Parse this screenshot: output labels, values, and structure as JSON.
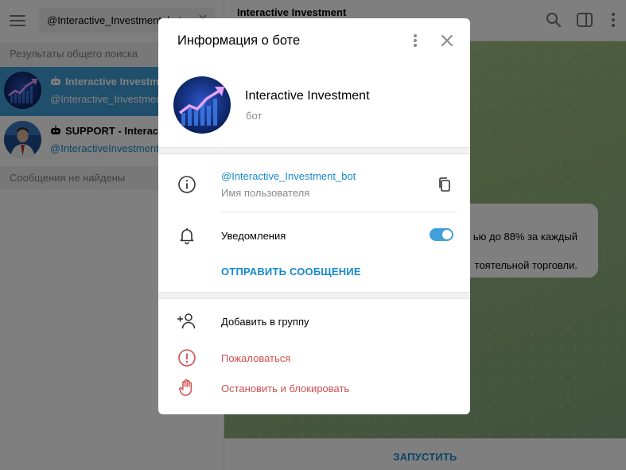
{
  "search": {
    "value": "@Interactive_Investment_bot"
  },
  "left": {
    "global_results_header": "Результаты общего поиска",
    "results": [
      {
        "title": "Interactive Investment",
        "username": "@Interactive_Investment_bot"
      },
      {
        "title": "SUPPORT - Interactive Investment",
        "username": "@InteractiveInvestmentSupport"
      }
    ],
    "messages_header": "Сообщения не найдены"
  },
  "chat": {
    "title": "Interactive Investment",
    "bubble_line1": "ью до 88% за каждый",
    "bubble_line2": "тоятельной торговли.",
    "start_label": "ЗАПУСТИТЬ"
  },
  "modal": {
    "title": "Информация о боте",
    "bot_name": "Interactive Investment",
    "bot_type": "бот",
    "username": "@Interactive_Investment_bot",
    "username_caption": "Имя пользователя",
    "notifications_label": "Уведомления",
    "notifications_on": true,
    "send_message_label": "ОТПРАВИТЬ СООБЩЕНИЕ",
    "add_to_group_label": "Добавить в группу",
    "report_label": "Пожаловаться",
    "block_label": "Остановить и блокировать"
  },
  "colors": {
    "accent": "#419fd9",
    "link": "#168acd",
    "danger": "#d14e4e",
    "chat_bg": "#97b57a"
  },
  "icons": [
    "menu-icon",
    "clear-icon",
    "search-icon",
    "sidebar-toggle-icon",
    "more-vert-icon",
    "close-icon",
    "info-icon",
    "copy-icon",
    "bell-icon",
    "add-user-icon",
    "report-icon",
    "hand-stop-icon",
    "bot-icon"
  ]
}
